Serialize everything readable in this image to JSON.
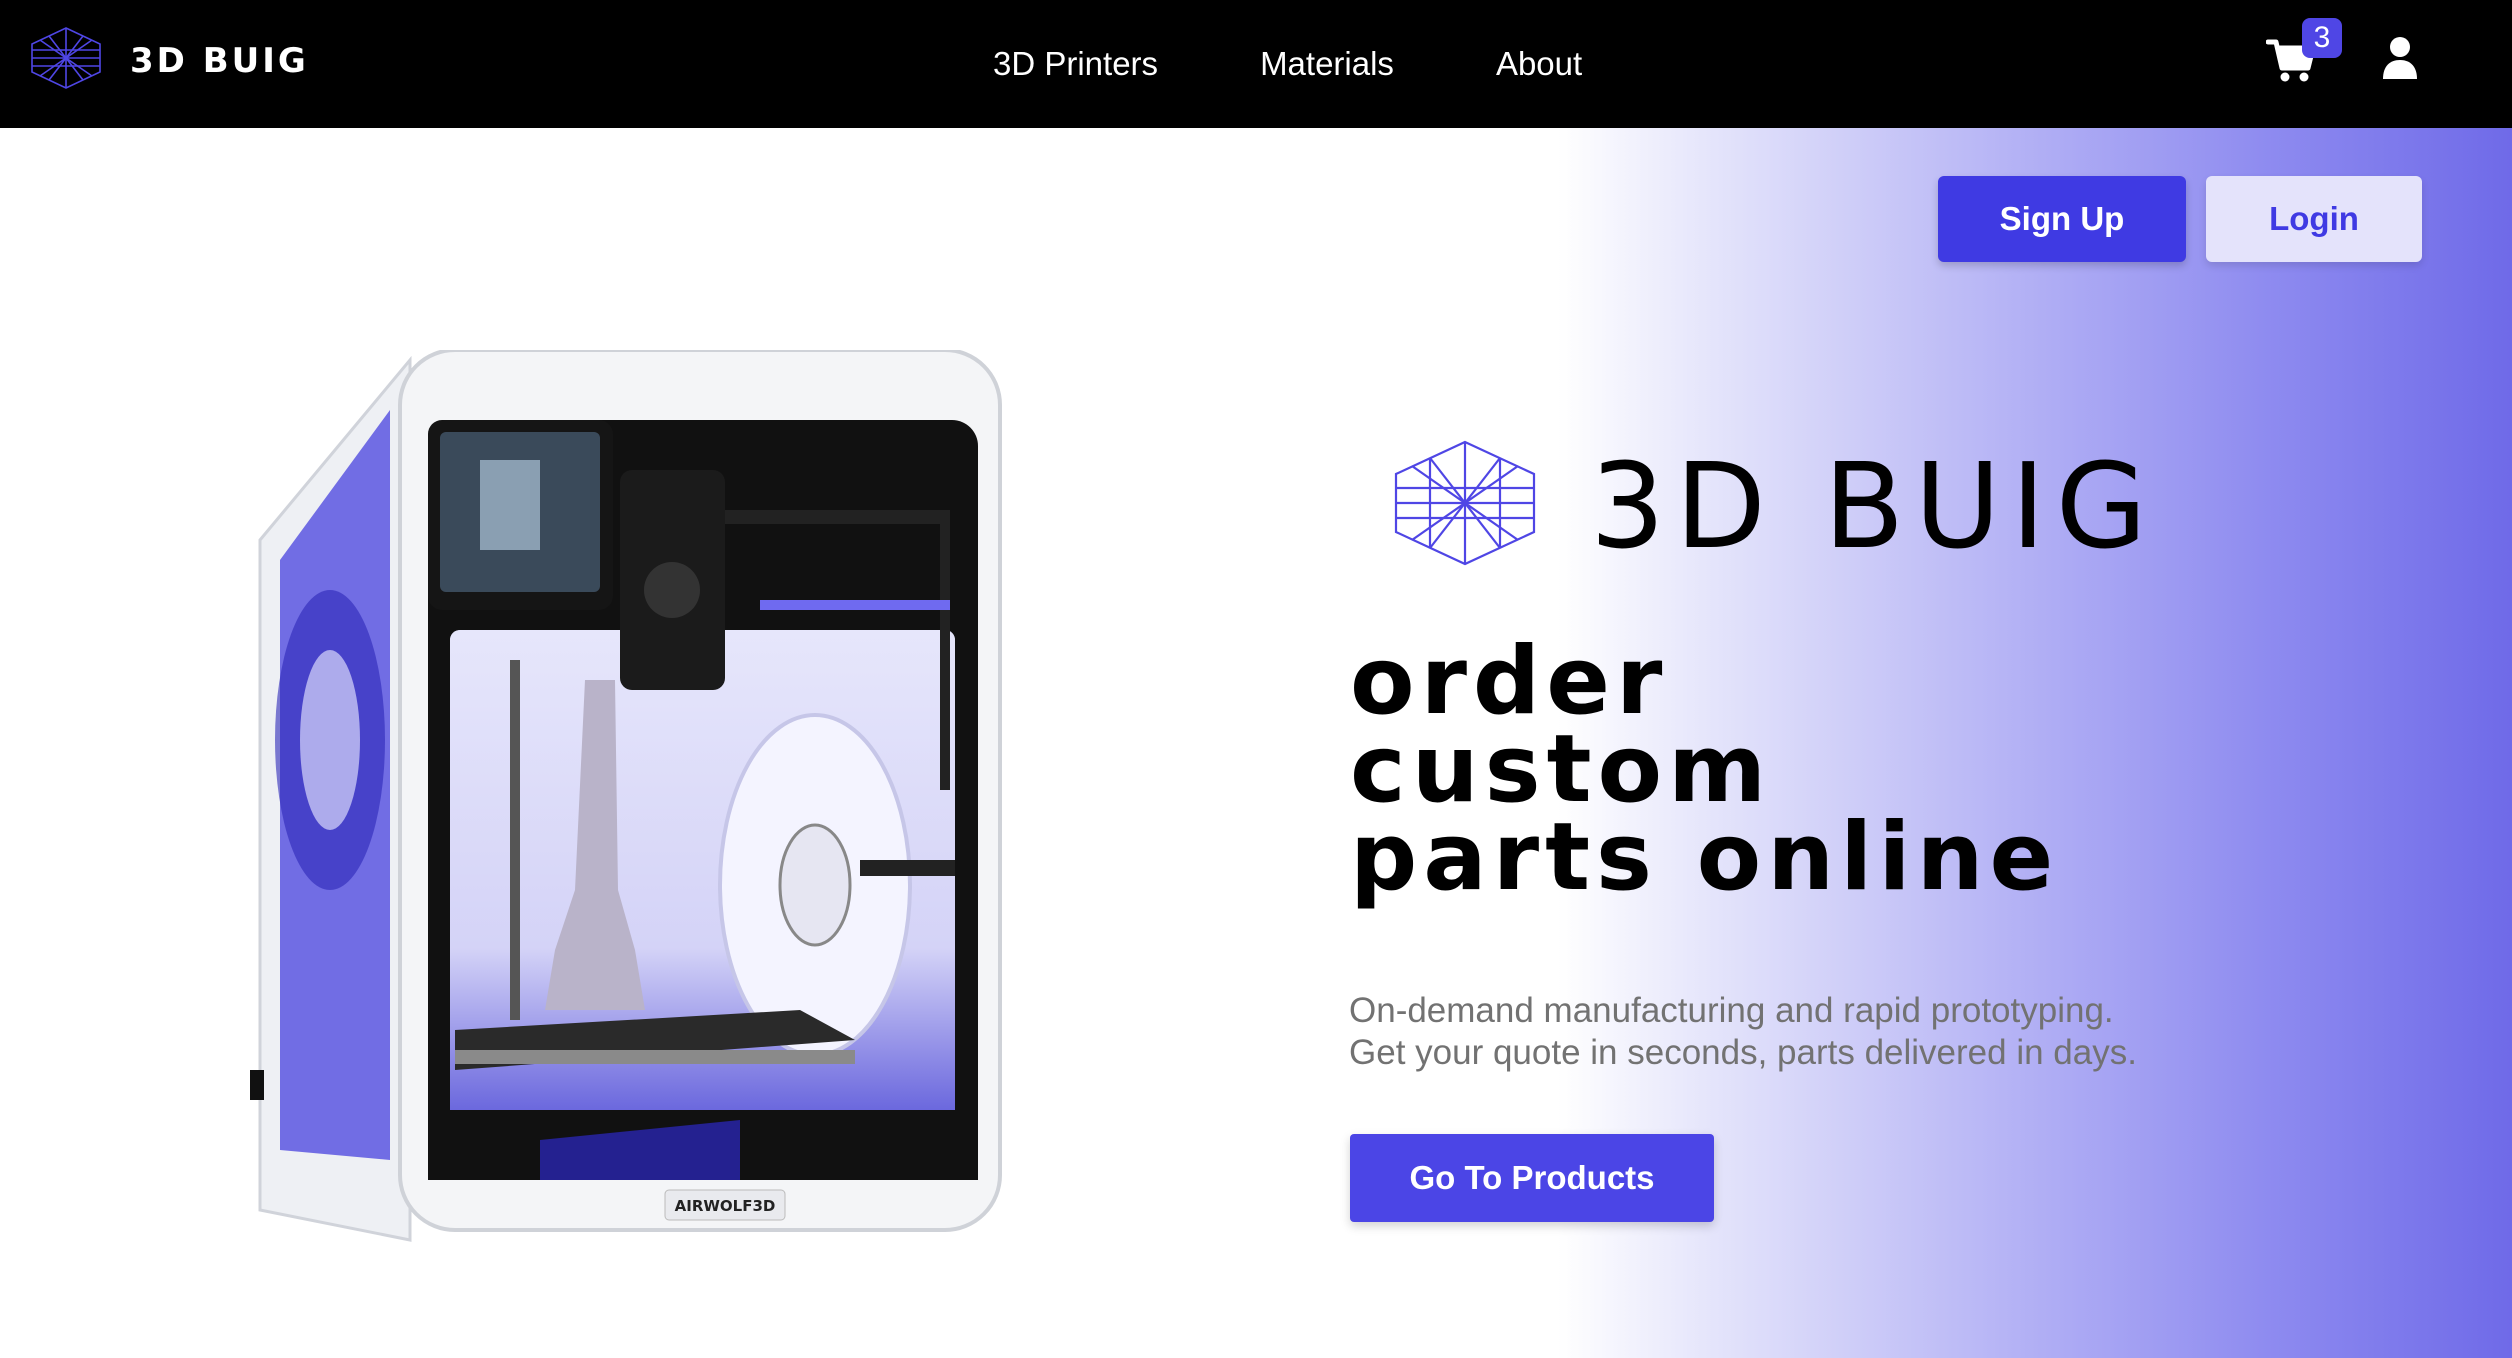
{
  "brand": {
    "name": "3D BUIG",
    "logo_icon": "hexagon-grid-icon"
  },
  "nav": {
    "links": [
      "3D Printers",
      "Materials",
      "About"
    ]
  },
  "cart": {
    "icon": "cart-icon",
    "count": "3"
  },
  "user": {
    "icon": "user-icon"
  },
  "auth": {
    "signup_label": "Sign Up",
    "login_label": "Login"
  },
  "hero": {
    "logo_text": "3D BUIG",
    "headline": [
      "Order",
      "Custom",
      "Parts Online"
    ],
    "subtext": [
      "On-demand manufacturing and rapid prototyping.",
      "Get your quote in seconds, parts delivered in days."
    ],
    "cta_label": "Go To Products",
    "printer_label": "AIRWOLF3D"
  },
  "colors": {
    "accent": "#4f46e5",
    "navbar": "#000000",
    "gradient_end": "#6f6ae8"
  }
}
